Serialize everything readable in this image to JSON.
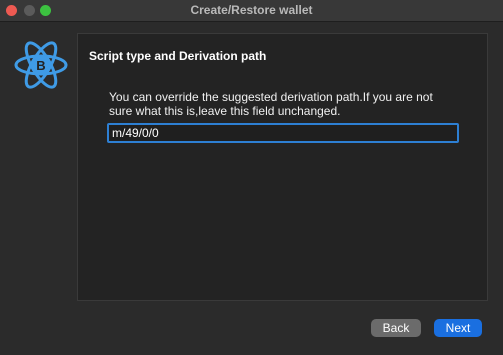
{
  "window": {
    "title": "Create/Restore wallet"
  },
  "panel": {
    "heading": "Script type and Derivation path",
    "description": "You can override the suggested derivation path.If you are not sure what this is,leave this field unchanged.",
    "derivation_path_value": "m/49/0/0"
  },
  "buttons": {
    "back": "Back",
    "next": "Next"
  },
  "colors": {
    "accent": "#1a6fe0",
    "logo": "#3f9be6"
  },
  "icons": {
    "logo": "electrum-bitcoin-logo"
  }
}
